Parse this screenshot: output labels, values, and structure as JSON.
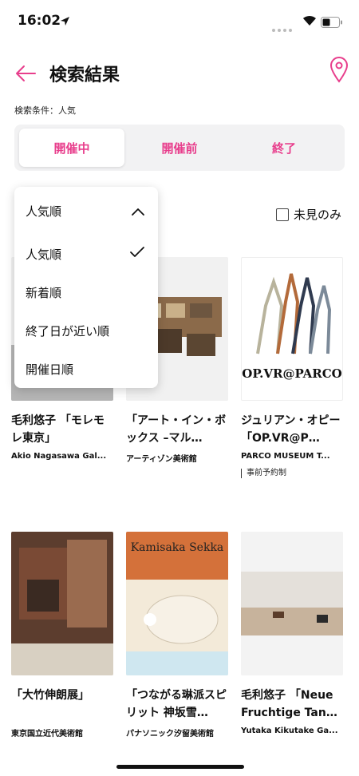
{
  "status_bar": {
    "time": "16:02"
  },
  "header": {
    "title": "検索結果"
  },
  "search_condition": "検索条件：人気",
  "tabs": [
    {
      "label": "開催中",
      "active": true
    },
    {
      "label": "開催前",
      "active": false
    },
    {
      "label": "終了",
      "active": false
    }
  ],
  "sort": {
    "current": "人気順",
    "options": [
      "人気順",
      "新着順",
      "終了日が近い順",
      "開催日順"
    ],
    "selected": "人気順"
  },
  "unseen_only_label": "未見のみ",
  "cards": [
    {
      "title": "毛利悠子 「モレモレ東京」",
      "venue": "Akio Nagasawa Gal..."
    },
    {
      "title": "「アート・イン・ボックス –マル…",
      "venue": "アーティゾン美術館"
    },
    {
      "title": "ジュリアン・オピー 「OP.VR@P…",
      "venue": "PARCO MUSEUM T...",
      "tag": "事前予約制",
      "poster_text": "OP.VR@PARCO"
    },
    {
      "title": "「大竹伸朗展」",
      "venue": "東京国立近代美術館"
    },
    {
      "title": "「つながる琳派スピリット 神坂雪…",
      "venue": "パナソニック汐留美術館",
      "poster_text": "Kamisaka Sekka"
    },
    {
      "title": "毛利悠子 「Neue Fruchtige Tan…",
      "venue": "Yutaka Kikutake Ga..."
    }
  ],
  "colors": {
    "accent": "#e83e8c",
    "tab_bg": "#f2f2f3"
  }
}
